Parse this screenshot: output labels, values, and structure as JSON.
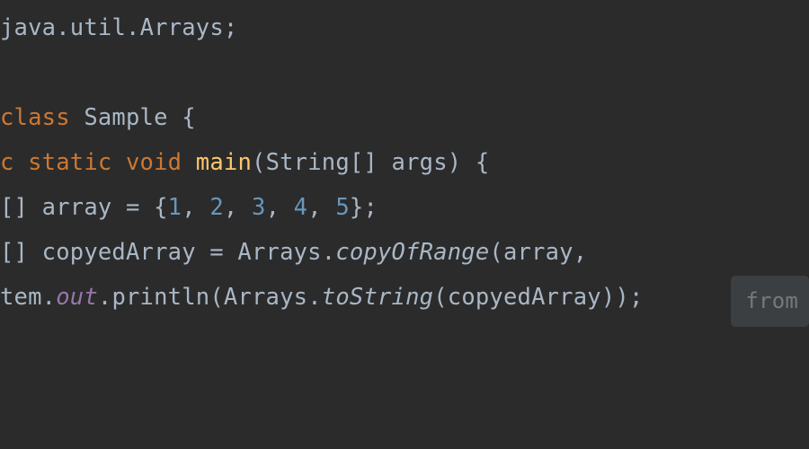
{
  "code": {
    "line1": {
      "pkg1": "java",
      "pkg2": "util",
      "pkg3": "Arrays"
    },
    "line3": {
      "kw_class": "class",
      "name": "Sample",
      "brace": " {"
    },
    "line4": {
      "mod1": "c ",
      "mod2": "static",
      "sp1": " ",
      "mod3": "void",
      "sp2": " ",
      "method": "main",
      "lp": "(",
      "ptype": "String[]",
      "sp3": " ",
      "pname": "args",
      "rp": ")",
      "brace": " {"
    },
    "line5": {
      "type": "[]",
      "sp1": " ",
      "var": "array",
      "eq": " = {",
      "n1": "1",
      "c1": ", ",
      "n2": "2",
      "c2": ", ",
      "n3": "3",
      "c3": ", ",
      "n4": "4",
      "c4": ", ",
      "n5": "5",
      "end": "};"
    },
    "line6": {
      "type": "[]",
      "sp1": " ",
      "var": "copyedArray",
      "eq": " = ",
      "cls": "Arrays",
      "dot": ".",
      "m": "copyOfRange",
      "lp": "(",
      "arg": "array",
      "c": ","
    },
    "line7": {
      "pre": "tem.",
      "out": "out",
      "dot": ".",
      "m1": "println",
      "lp": "(",
      "cls": "Arrays",
      "dot2": ".",
      "m2": "toString",
      "lp2": "(",
      "arg": "copyedArray",
      "end": "));"
    }
  },
  "hint": {
    "label": "from"
  }
}
